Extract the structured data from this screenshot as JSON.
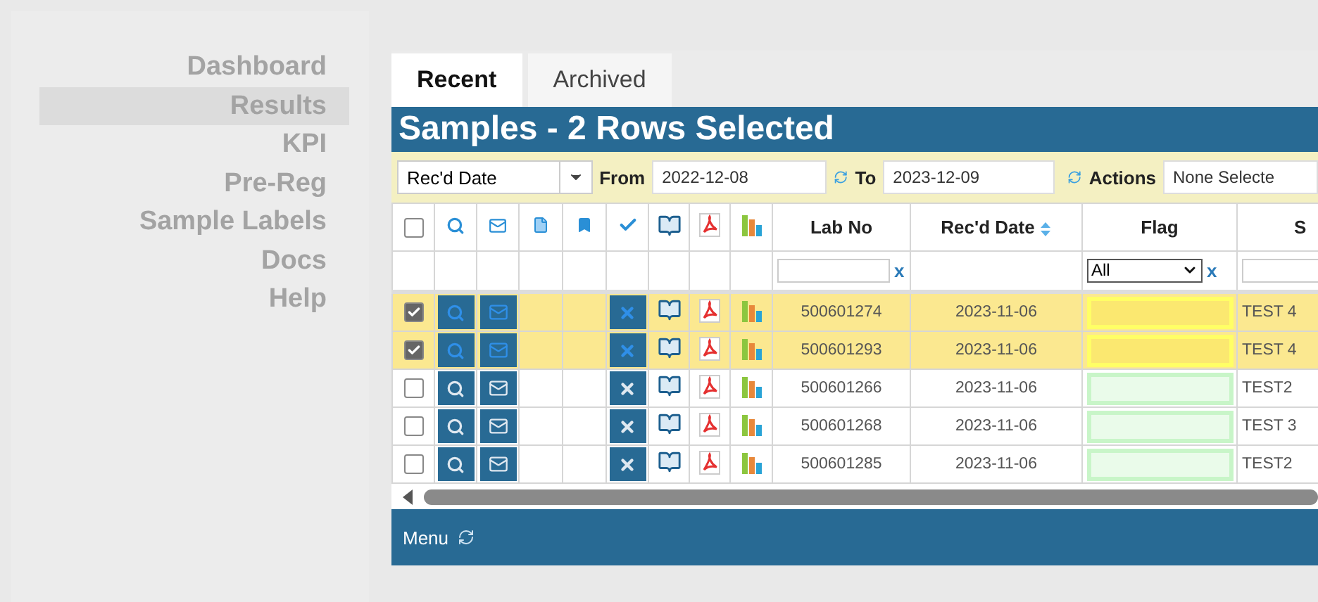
{
  "sidebar": {
    "items": [
      {
        "label": "Dashboard",
        "selected": false
      },
      {
        "label": "Results",
        "selected": true
      },
      {
        "label": "KPI",
        "selected": false
      },
      {
        "label": "Pre-Reg",
        "selected": false
      },
      {
        "label": "Sample Labels",
        "selected": false
      },
      {
        "label": "Docs",
        "selected": false
      },
      {
        "label": "Help",
        "selected": false
      }
    ]
  },
  "tabs": [
    {
      "label": "Recent",
      "selected": true
    },
    {
      "label": "Archived",
      "selected": false
    }
  ],
  "panel_title": "Samples - 2 Rows Selected",
  "filter_bar": {
    "date_field": "Rec'd Date",
    "from_label": "From",
    "from_value": "2022-12-08",
    "to_label": "To",
    "to_value": "2023-12-09",
    "actions_label": "Actions",
    "actions_value": "None Selecte"
  },
  "table": {
    "columns": [
      {
        "kind": "checkbox",
        "checked": false
      },
      {
        "kind": "icon"
      },
      {
        "kind": "icon"
      },
      {
        "kind": "icon"
      },
      {
        "kind": "icon"
      },
      {
        "kind": "icon"
      },
      {
        "kind": "icon"
      },
      {
        "kind": "icon"
      },
      {
        "kind": "icon"
      },
      {
        "kind": "text",
        "label": "Lab No",
        "sorted": false,
        "filter": {
          "kind": "input",
          "clear": "x"
        }
      },
      {
        "kind": "text",
        "label": "Rec'd Date",
        "sorted": true
      },
      {
        "kind": "text",
        "label": "Flag",
        "sorted": false,
        "filter": {
          "kind": "select",
          "value": "All",
          "clear": "x"
        }
      },
      {
        "kind": "text",
        "label": "S",
        "sorted": false,
        "filter": {
          "kind": "input"
        }
      }
    ],
    "rows": [
      {
        "selected": true,
        "lab_no": "500601274",
        "recd_date": "2023-11-06",
        "color": "#ffff66",
        "sa": "TEST 4"
      },
      {
        "selected": true,
        "lab_no": "500601293",
        "recd_date": "2023-11-06",
        "color": "#ffff66",
        "sa": "TEST 4"
      },
      {
        "selected": false,
        "lab_no": "500601266",
        "recd_date": "2023-11-06",
        "color": "#c8f5c8",
        "sa": "TEST2"
      },
      {
        "selected": false,
        "lab_no": "500601268",
        "recd_date": "2023-11-06",
        "color": "#c8f5c8",
        "sa": "TEST 3"
      },
      {
        "selected": false,
        "lab_no": "500601285",
        "recd_date": "2023-11-06",
        "color": "#c8f5c8",
        "sa": "TEST2"
      }
    ]
  },
  "footer": {
    "menu": "Menu"
  }
}
